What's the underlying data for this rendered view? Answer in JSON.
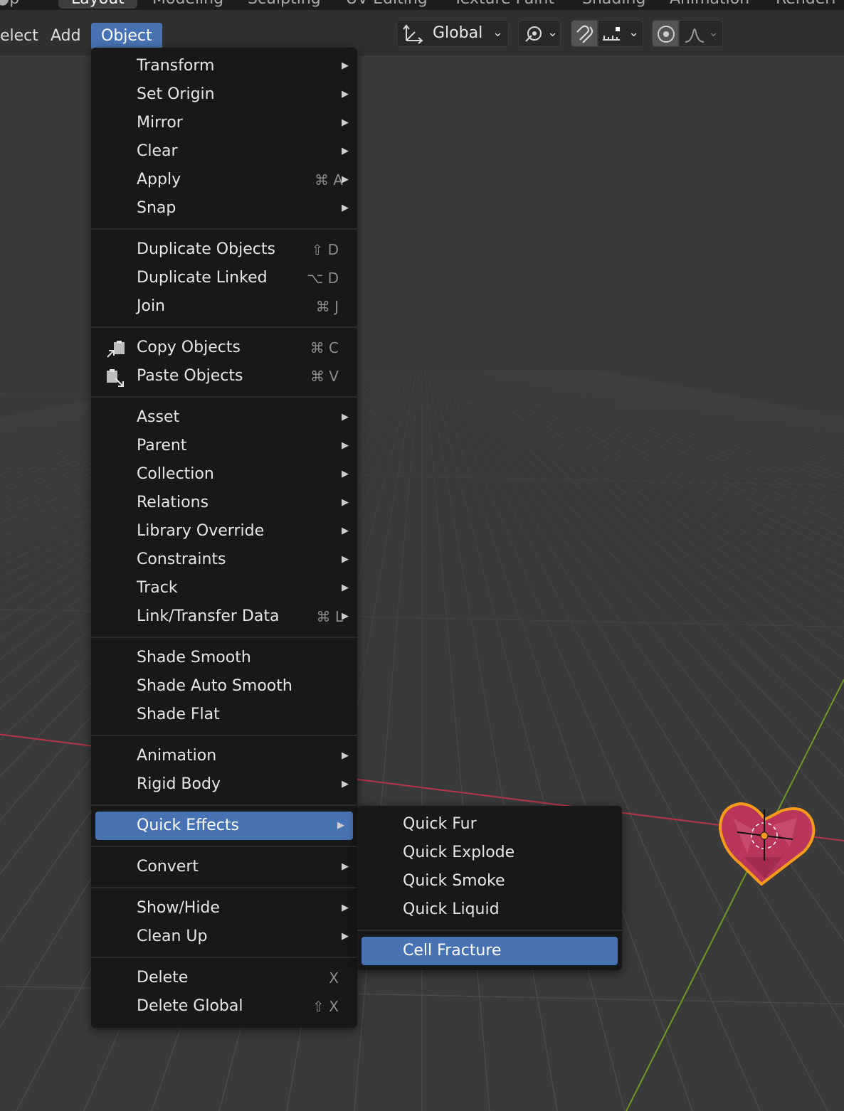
{
  "workspace_tabs": [
    "Layout",
    "Modeling",
    "Sculpting",
    "UV Editing",
    "Texture Paint",
    "Shading",
    "Animation",
    "Renderi"
  ],
  "header": {
    "menus": [
      "elect",
      "Add",
      "Object"
    ],
    "orientation": "Global"
  },
  "object_menu": {
    "groups": [
      [
        {
          "label": "Transform",
          "submenu": true
        },
        {
          "label": "Set Origin",
          "submenu": true
        },
        {
          "label": "Mirror",
          "submenu": true
        },
        {
          "label": "Clear",
          "submenu": true
        },
        {
          "label": "Apply",
          "shortcut": "⌘ A",
          "submenu": true
        },
        {
          "label": "Snap",
          "submenu": true
        }
      ],
      [
        {
          "label": "Duplicate Objects",
          "shortcut": "⇧ D"
        },
        {
          "label": "Duplicate Linked",
          "shortcut": "⌥ D"
        },
        {
          "label": "Join",
          "shortcut": "⌘ J"
        }
      ],
      [
        {
          "label": "Copy Objects",
          "shortcut": "⌘ C",
          "icon": "copy-icon"
        },
        {
          "label": "Paste Objects",
          "shortcut": "⌘ V",
          "icon": "paste-icon"
        }
      ],
      [
        {
          "label": "Asset",
          "submenu": true
        },
        {
          "label": "Parent",
          "submenu": true
        },
        {
          "label": "Collection",
          "submenu": true
        },
        {
          "label": "Relations",
          "submenu": true
        },
        {
          "label": "Library Override",
          "submenu": true
        },
        {
          "label": "Constraints",
          "submenu": true
        },
        {
          "label": "Track",
          "submenu": true
        },
        {
          "label": "Link/Transfer Data",
          "shortcut": "⌘ L",
          "submenu": true
        }
      ],
      [
        {
          "label": "Shade Smooth"
        },
        {
          "label": "Shade Auto Smooth"
        },
        {
          "label": "Shade Flat"
        }
      ],
      [
        {
          "label": "Animation",
          "submenu": true
        },
        {
          "label": "Rigid Body",
          "submenu": true
        }
      ],
      [
        {
          "label": "Quick Effects",
          "submenu": true,
          "highlighted": true
        }
      ],
      [
        {
          "label": "Convert",
          "submenu": true
        }
      ],
      [
        {
          "label": "Show/Hide",
          "submenu": true
        },
        {
          "label": "Clean Up",
          "submenu": true
        }
      ],
      [
        {
          "label": "Delete",
          "shortcut": "X"
        },
        {
          "label": "Delete Global",
          "shortcut": "⇧ X"
        }
      ]
    ]
  },
  "quick_effects_menu": {
    "items": [
      {
        "label": "Quick Fur"
      },
      {
        "label": "Quick Explode"
      },
      {
        "label": "Quick Smoke"
      },
      {
        "label": "Quick Liquid"
      },
      {
        "label": "Cell Fracture",
        "highlighted": true
      }
    ]
  },
  "colors": {
    "accent": "#4772b3",
    "menu_bg": "#181818",
    "viewport_bg": "#3a3a3a",
    "selection_outline": "#f59a1b",
    "x_axis": "#b5364a",
    "y_axis": "#6b9a1e",
    "heart": "#b9365a"
  }
}
